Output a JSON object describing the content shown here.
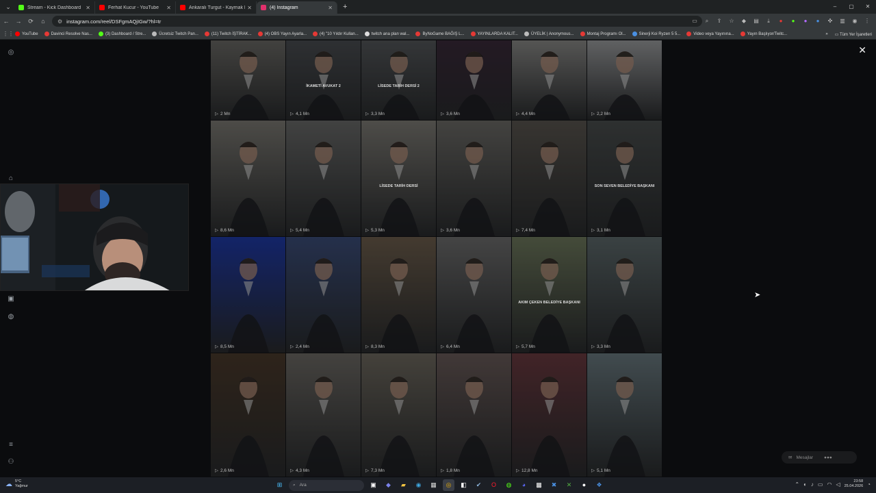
{
  "tabs": [
    {
      "label": "Stream - Kick Dashboard",
      "color": "#53fc18",
      "active": false
    },
    {
      "label": "Ferhat Kucur - YouTube",
      "color": "#ff0000",
      "active": false
    },
    {
      "label": "Ankaralı Turgut - Kaymak Lazım",
      "color": "#ff0000",
      "active": false
    },
    {
      "label": "(4) Instagram",
      "color": "#e1306c",
      "active": true
    }
  ],
  "new_tab": "+",
  "window_controls": {
    "minimize": "–",
    "maximize": "▢",
    "close": "✕"
  },
  "address": {
    "url": "instagram.com/reel/DSFgmAQjIGw/?hl=tr"
  },
  "bookmarks": [
    "YouTube",
    "Davinci Resolve Nas...",
    "(3) Dashboard / Stre...",
    "Ücretsiz Twitch Pan...",
    "(11) Twitch İŞTİRAK...",
    "(4) OBS Yayın Ayarla...",
    "(4) \"10 Yıldır Kullan...",
    "twitch ana plan wal...",
    "ByNoGame BAĞIŞ L...",
    "YAYINLARDA KALIT...",
    "ÜYELİK | Anonymous...",
    "Montaj Programı Ol...",
    "Sinerji Koi Ryzen 5 5...",
    "Video veya Yayınına...",
    "Yayın Başlıyor/Twitc..."
  ],
  "bookmarks_more": "»",
  "bookmarks_all": "Tüm Yer İşaretleri",
  "reels": [
    {
      "caption": "",
      "views": "2 Mn",
      "tone": "#6b6a66"
    },
    {
      "caption": "İKAMETİ AVUKAT 2",
      "views": "4,1 Mn",
      "tone": "#4b4e52"
    },
    {
      "caption": "LİSEDE TARİH DERSİ 2",
      "views": "3,3 Mn",
      "tone": "#55585b"
    },
    {
      "caption": "",
      "views": "3,6 Mn",
      "tone": "#3a2a3a"
    },
    {
      "caption": "",
      "views": "4,4 Mn",
      "tone": "#8a8a88"
    },
    {
      "caption": "",
      "views": "2,2 Mn",
      "tone": "#9b9d9f"
    },
    {
      "caption": "",
      "views": "8,6 Mn",
      "tone": "#7c7a74"
    },
    {
      "caption": "",
      "views": "5,4 Mn",
      "tone": "#6a6b6a"
    },
    {
      "caption": "LİSEDE TARİH DERSİ",
      "views": "5,3 Mn",
      "tone": "#7e7c76"
    },
    {
      "caption": "",
      "views": "3,6 Mn",
      "tone": "#6d6c68"
    },
    {
      "caption": "",
      "views": "7,4 Mn",
      "tone": "#5a5650"
    },
    {
      "caption": "SON SEVEN BELEDİYE BAŞKANI",
      "views": "3,1 Mn",
      "tone": "#4a4e4e"
    },
    {
      "caption": "",
      "views": "8,5 Mn",
      "tone": "#1f3aa8"
    },
    {
      "caption": "",
      "views": "2,4 Mn",
      "tone": "#3c4e7a"
    },
    {
      "caption": "",
      "views": "8,3 Mn",
      "tone": "#6e5f4e"
    },
    {
      "caption": "",
      "views": "6,4 Mn",
      "tone": "#6f6f6f"
    },
    {
      "caption": "AKIM ÇEKEN BELEDİYE BAŞKANI",
      "views": "5,7 Mn",
      "tone": "#6f7a5e"
    },
    {
      "caption": "",
      "views": "3,3 Mn",
      "tone": "#5e6a6c"
    },
    {
      "caption": "",
      "views": "2,6 Mn",
      "tone": "#4b3a2c"
    },
    {
      "caption": "",
      "views": "4,3 Mn",
      "tone": "#6e6b66"
    },
    {
      "caption": "",
      "views": "7,3 Mn",
      "tone": "#6f6a60"
    },
    {
      "caption": "",
      "views": "1,8 Mn",
      "tone": "#6a5c5a"
    },
    {
      "caption": "",
      "views": "12,8 Mn",
      "tone": "#6a3a40"
    },
    {
      "caption": "",
      "views": "5,1 Mn",
      "tone": "#6a7a80"
    }
  ],
  "messages": {
    "label": "Mesajlar"
  },
  "close_icon": "✕",
  "taskbar": {
    "weather_temp": "5°C",
    "weather_desc": "Yağmur",
    "search_placeholder": "Ara",
    "time": "23:58",
    "date": "25.04.2026"
  }
}
